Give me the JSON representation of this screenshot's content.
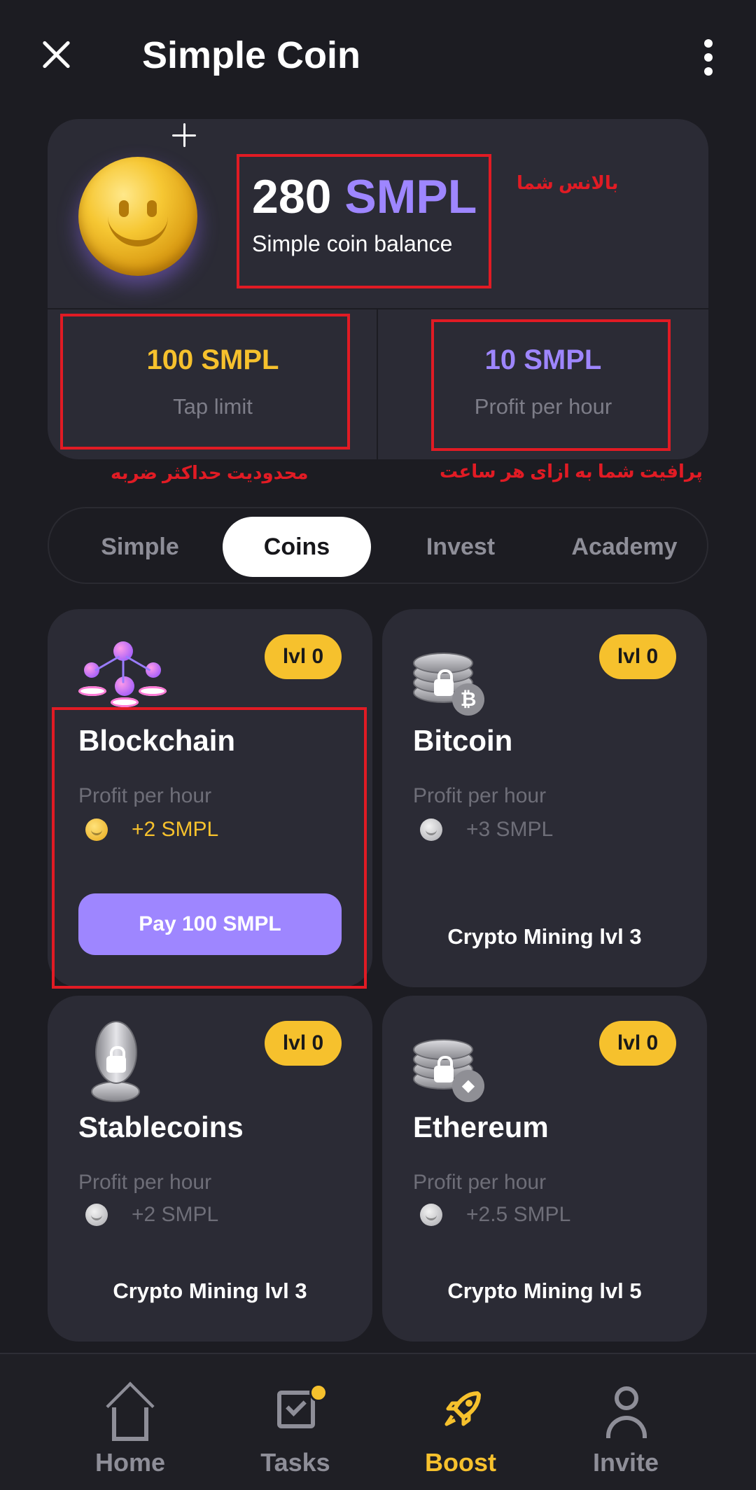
{
  "header": {
    "title": "Simple Coin"
  },
  "balance": {
    "amount": "280",
    "unit": "SMPL",
    "label": "Simple coin balance",
    "annotation": "بالانس شما"
  },
  "stats": {
    "tap_limit_value": "100 SMPL",
    "tap_limit_label": "Tap limit",
    "tap_limit_annotation": "محدودیت حداکثر ضربه",
    "profit_value": "10 SMPL",
    "profit_label": "Profit per hour",
    "profit_annotation": "پرافیت شما به ازای هر ساعت"
  },
  "tabs": [
    {
      "label": "Simple",
      "active": false
    },
    {
      "label": "Coins",
      "active": true
    },
    {
      "label": "Invest",
      "active": false
    },
    {
      "label": "Academy",
      "active": false
    }
  ],
  "cards": [
    {
      "title": "Blockchain",
      "level": "lvl 0",
      "sub": "Profit per hour",
      "profit": "+2 SMPL",
      "action": "Pay 100 SMPL",
      "icon": "network-icon"
    },
    {
      "title": "Bitcoin",
      "level": "lvl 0",
      "sub": "Profit per hour",
      "profit": "+3 SMPL",
      "requirement": "Crypto Mining lvl 3",
      "icon": "locked-bitcoin-icon",
      "badge_symbol": "₿"
    },
    {
      "title": "Stablecoins",
      "level": "lvl 0",
      "sub": "Profit per hour",
      "profit": "+2 SMPL",
      "requirement": "Crypto Mining lvl 3",
      "icon": "locked-stablecoin-icon"
    },
    {
      "title": "Ethereum",
      "level": "lvl 0",
      "sub": "Profit per hour",
      "profit": "+2.5 SMPL",
      "requirement": "Crypto Mining lvl 5",
      "icon": "locked-ethereum-icon",
      "badge_symbol": "◆"
    }
  ],
  "nav": [
    {
      "label": "Home",
      "icon": "home-icon",
      "active": false
    },
    {
      "label": "Tasks",
      "icon": "tasks-icon",
      "active": false
    },
    {
      "label": "Boost",
      "icon": "rocket-icon",
      "active": true
    },
    {
      "label": "Invite",
      "icon": "person-icon",
      "active": false
    }
  ],
  "colors": {
    "background": "#1c1c22",
    "card": "#2b2b35",
    "accent_purple": "#9e86ff",
    "accent_gold": "#f6c12d",
    "annotation_red": "#e11b24"
  }
}
